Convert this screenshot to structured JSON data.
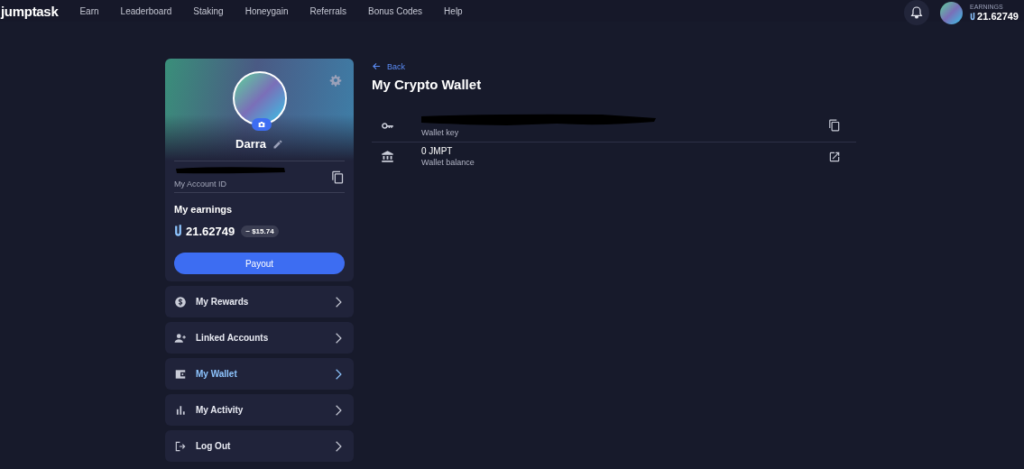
{
  "topbar": {
    "logo": "jumptask",
    "nav": [
      {
        "label": "Earn"
      },
      {
        "label": "Leaderboard"
      },
      {
        "label": "Staking"
      },
      {
        "label": "Honeygain"
      },
      {
        "label": "Referrals"
      },
      {
        "label": "Bonus Codes"
      },
      {
        "label": "Help"
      }
    ],
    "earnings_label": "EARNINGS",
    "earnings_value": "21.62749"
  },
  "profile": {
    "name": "Darra",
    "account_id_label": "My Account ID",
    "earnings_title": "My earnings",
    "earnings_value": "21.62749",
    "earnings_usd": "~ $15.74",
    "payout_button": "Payout"
  },
  "menu": [
    {
      "label": "My Rewards",
      "selected": false
    },
    {
      "label": "Linked Accounts",
      "selected": false
    },
    {
      "label": "My Wallet",
      "selected": true
    },
    {
      "label": "My Activity",
      "selected": false
    },
    {
      "label": "Log Out",
      "selected": false
    }
  ],
  "main": {
    "back": "Back",
    "title": "My Crypto Wallet",
    "rows": [
      {
        "label": "Wallet key"
      },
      {
        "value": "0 JMPT",
        "label": "Wallet balance"
      }
    ]
  }
}
